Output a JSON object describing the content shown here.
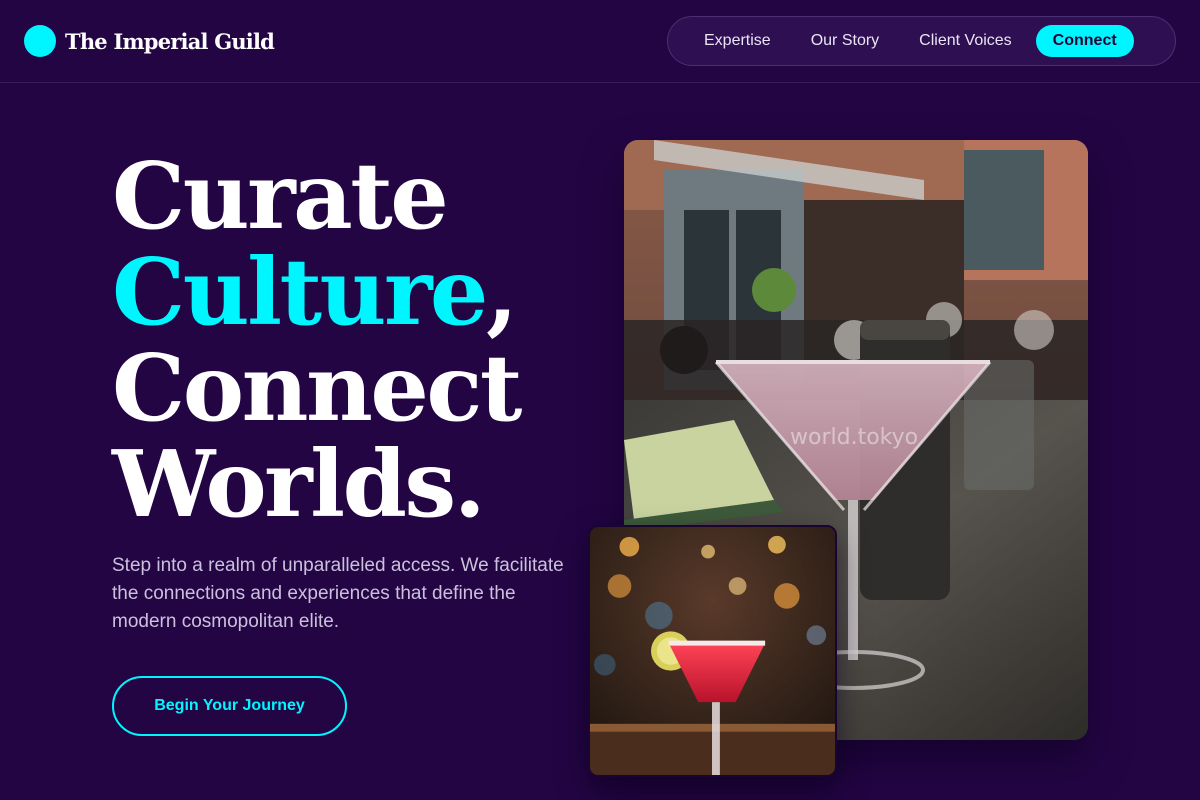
{
  "brand": {
    "name": "The Imperial Guild",
    "accent_color": "#00f6ff"
  },
  "nav": {
    "links": [
      "Expertise",
      "Our Story",
      "Client Voices"
    ],
    "cta_label": "Connect"
  },
  "hero": {
    "headline_line1": "Curate",
    "headline_line2_accent": "Culture",
    "headline_line2_suffix": ",",
    "headline_line3": "Connect",
    "headline_line4": "Worlds.",
    "subtext": "Step into a realm of unparalleled access. We facilitate the connections and experiences that define the modern cosmopolitan elite.",
    "cta_label": "Begin Your Journey"
  },
  "images": {
    "main_watermark": "world.tokyo",
    "main_icon": "martini-patio-photo",
    "small_icon": "margarita-bar-photo"
  },
  "colors": {
    "background": "#230544",
    "accent": "#00f6ff",
    "nav_bg": "#2e0f52"
  }
}
